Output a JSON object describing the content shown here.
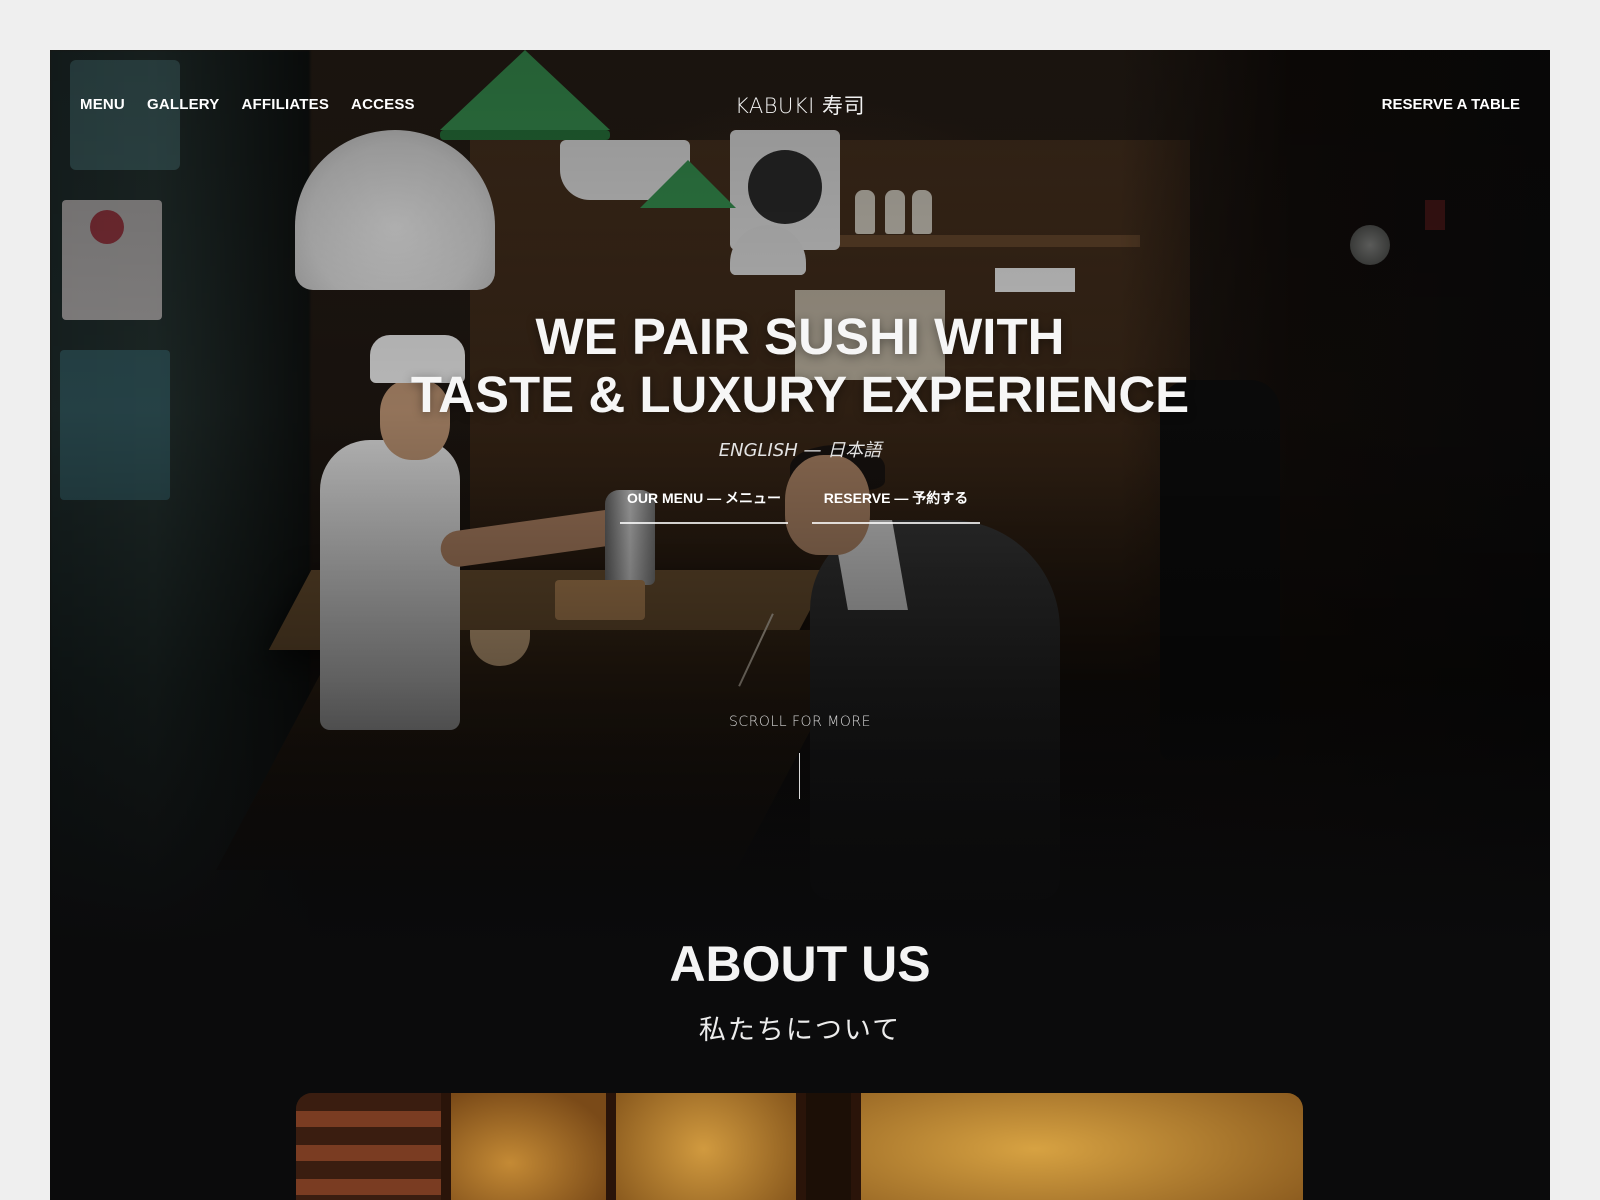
{
  "nav": {
    "left_items": [
      "MENU",
      "GALLERY",
      "AFFILIATES",
      "ACCESS"
    ],
    "logo": "KABUKI 寿司",
    "reserve_label": "RESERVE A TABLE"
  },
  "hero": {
    "headline_line1": "WE PAIR SUSHI WITH",
    "headline_line2": "TASTE & LUXURY EXPERIENCE",
    "language_toggle": "ENGLISH — 日本語",
    "cta_menu": "OUR MENU — メニュー",
    "cta_reserve": "RESERVE — 予約する",
    "scroll_hint": "SCROLL FOR MORE"
  },
  "about": {
    "title": "ABOUT US",
    "subtitle": "私たちについて"
  },
  "colors": {
    "page_background": "#efefef",
    "site_background": "#0b0b0c",
    "text": "#ffffff"
  }
}
